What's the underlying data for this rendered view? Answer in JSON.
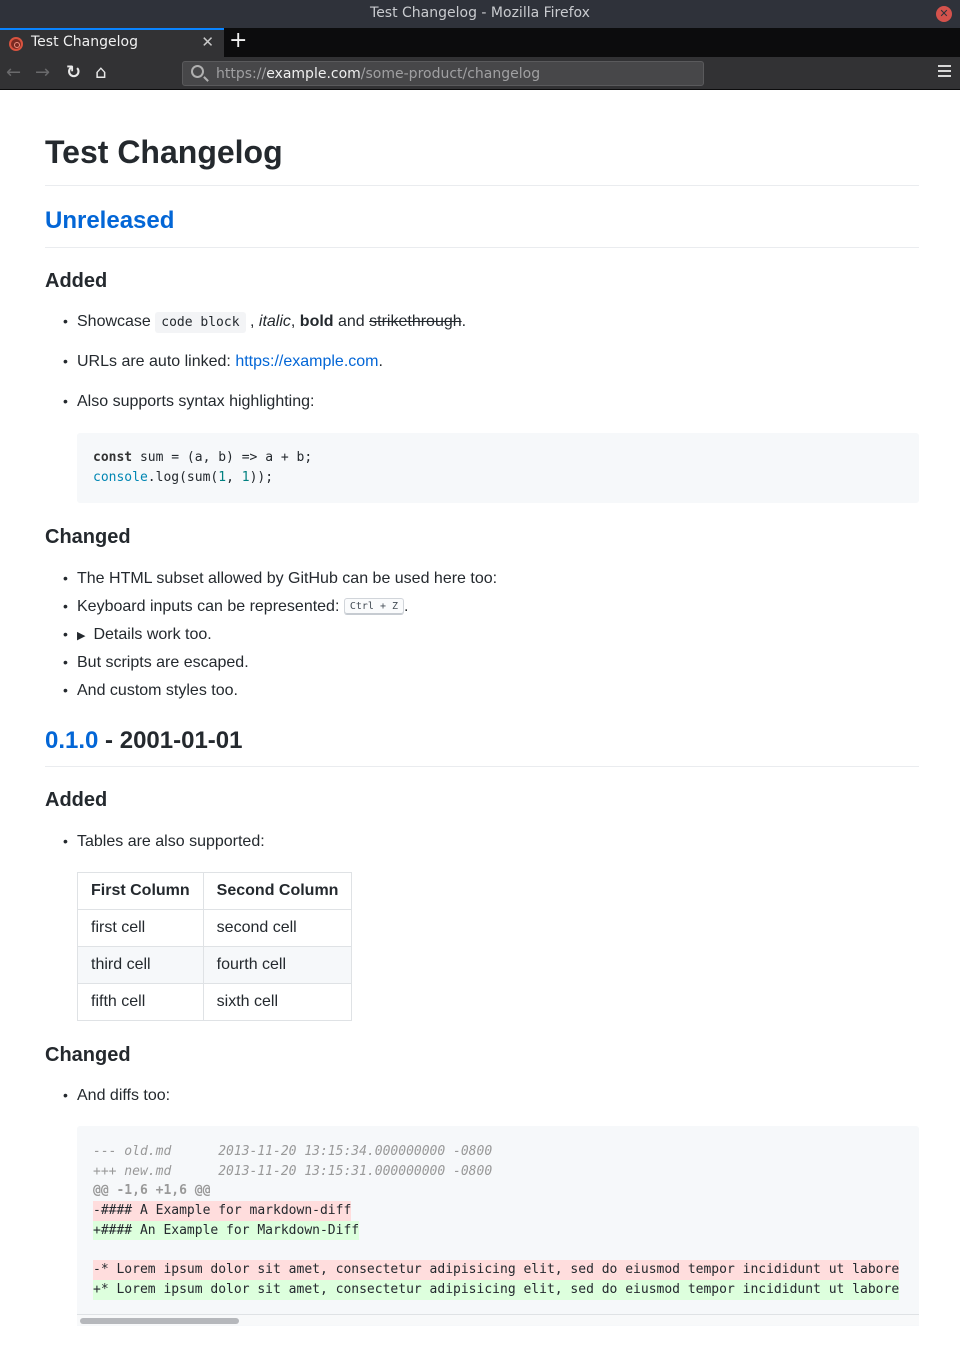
{
  "window": {
    "title": "Test Changelog - Mozilla Firefox"
  },
  "tabs": [
    {
      "label": "Test Changelog",
      "active": true
    }
  ],
  "toolbar": {
    "new_tab_label": "+",
    "tab_close_glyph": "✕",
    "back_glyph": "←",
    "forward_glyph": "→",
    "reload_glyph": "↻",
    "home_glyph": "⌂",
    "url_scheme": "https://",
    "url_host": "example.com",
    "url_path": "/some-product/changelog",
    "window_close_glyph": "✕"
  },
  "colors": {
    "link": "#0366d6",
    "tab_accent": "#0a84ff",
    "diff_deleted_bg": "#ffdddd",
    "diff_inserted_bg": "#ddffdd"
  },
  "page": {
    "title": "Test Changelog",
    "releases": [
      {
        "version": "Unreleased",
        "date": "",
        "sections": [
          {
            "heading": "Added",
            "items": {
              "showcase": {
                "prefix": "Showcase ",
                "code": "code block",
                "sep1": " , ",
                "italic": "italic",
                "sep2": ", ",
                "bold": "bold",
                "sep3": " and ",
                "strike": "strikethrough",
                "suffix": "."
              },
              "urls": {
                "prefix": "URLs are auto linked: ",
                "link": "https://example.com",
                "suffix": "."
              },
              "syntax": {
                "text": "Also supports syntax highlighting:"
              }
            },
            "code": {
              "line1": {
                "kw": "const",
                "rest": " sum = (a, b) => a + b;"
              },
              "line2": {
                "builtin": "console",
                "a": ".log(sum(",
                "n1": "1",
                "b": ", ",
                "n2": "1",
                "c": "));"
              }
            }
          },
          {
            "heading": "Changed",
            "items": {
              "html_subset": "The HTML subset allowed by GitHub can be used here too:",
              "keyboard_prefix": "Keyboard inputs can be represented: ",
              "keyboard_kbd": "Ctrl + Z",
              "keyboard_suffix": ".",
              "details_marker": "▶",
              "details": "Details work too.",
              "scripts": "But scripts are escaped.",
              "styles": "And custom styles too."
            }
          }
        ]
      },
      {
        "version": "0.1.0",
        "separator": " - ",
        "date": "2001-01-01",
        "sections": [
          {
            "heading": "Added",
            "items": {
              "tables": "Tables are also supported:"
            },
            "table": {
              "headers": [
                "First Column",
                "Second Column"
              ],
              "rows": [
                [
                  "first cell",
                  "second cell"
                ],
                [
                  "third cell",
                  "fourth cell"
                ],
                [
                  "fifth cell",
                  "sixth cell"
                ]
              ]
            }
          },
          {
            "heading": "Changed",
            "items": {
              "diffs": "And diffs too:"
            },
            "diff": {
              "lines": [
                "--- old.md      2013-11-20 13:15:34.000000000 -0800",
                "+++ new.md      2013-11-20 13:15:31.000000000 -0800",
                "@@ -1,6 +1,6 @@",
                "-#### A Example for markdown-diff",
                "+#### An Example for Markdown-Diff",
                "",
                "-* Lorem ipsum dolor sit amet, consectetur adipisicing elit, sed do eiusmod tempor incididunt ut labore",
                "+* Lorem ipsum dolor sit amet, consectetur adipisicing elit, sed do eiusmod tempor incididunt ut labore"
              ]
            }
          }
        ]
      }
    ]
  }
}
